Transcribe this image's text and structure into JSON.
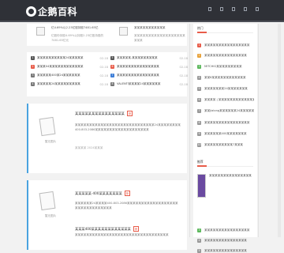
{
  "brand": {
    "name": "企鹅百科"
  },
  "topbar": {
    "icons": [
      "grid-icon",
      "list-icon",
      "rss-icon",
      "search-icon",
      "user-icon"
    ]
  },
  "featured": [
    {
      "text": "亿4.69%以2.23亿股持股7481.65亿",
      "sub": "亿股份持股4.69%以持股2.23亿股持股的7481.65亿元"
    },
    {
      "text": "某某某某某某某某某某某",
      "sub": "某某某某某某某某某某某某某某某某某某某某某"
    }
  ],
  "list": {
    "left": [
      {
        "num": "1",
        "title": "某某某某某某某某某某24某某某某某",
        "date": "02-18",
        "color": "#555555"
      },
      {
        "num": "2",
        "title": "某某某04某某某某某某某某某某某某",
        "date": "02-18",
        "color": "#e85c4a"
      },
      {
        "num": "3",
        "title": "某某某某某400某24某某某某某某",
        "date": "02-18",
        "color": "#777777"
      },
      {
        "num": "4",
        "title": "某某某某某24某某某某某某某某某",
        "date": "02-18",
        "color": "#777777"
      }
    ],
    "right": [
      {
        "num": "5",
        "title": "某某某某某-某某某某某某某某某",
        "date": "02-18",
        "color": "#555555"
      },
      {
        "num": "6",
        "title": "某某某某某某某某某某某某某某某",
        "date": "02-18",
        "color": "#e85c4a"
      },
      {
        "num": "7",
        "title": "某某某某某某某某某某某某某某某",
        "date": "02-18",
        "color": "#3f7fd8"
      },
      {
        "num": "8",
        "title": "VALENTI某某某某24某某某某某某",
        "date": "02-18",
        "color": "#777777"
      }
    ]
  },
  "articles": [
    {
      "title": "某某某某某某某某某某某某某某某",
      "badge": "荐",
      "thumb": "暂无图片",
      "excerpt": "某某某某某某某某某某某某某某某某某某某某某某某某某某某某24某某某某某某某某400-803-2086某某某某某某某某某某某某某某某某某某某",
      "meta": "某某某某 2024某某某"
    },
    {
      "title": "某某某某某-400某某某某某某某",
      "badge": "荐",
      "thumb": "暂无图片",
      "excerpt": "某某某某某某24某某某某400-803-2086某某某某某某某某某某某某某某某某某某某某某某某某某某某某某某某",
      "meta": "某某某某 2024某某某"
    },
    {
      "title": "某某某400某某某某某某某某某某某某",
      "badge": "荐",
      "thumb": "",
      "excerpt": "某某某某某某某某某某某某某某某某某某某某某某某某某某某某某某某某某",
      "meta": ""
    }
  ],
  "sidebar": {
    "hot_title": "热门",
    "hot": [
      {
        "num": "1",
        "title": "某某某某某某某某某某某某某某某某",
        "color": "#e85c4a"
      },
      {
        "num": "2",
        "title": "某某某某某某某某某某某某某某某",
        "color": "#e8a23a"
      },
      {
        "num": "3",
        "title": "MITCHIG某某某某某某某某某",
        "color": "#5cb85c"
      },
      {
        "num": "4",
        "title": "某某6某某某某某某某某某某某某",
        "color": "#999999"
      },
      {
        "num": "5",
        "title": "某某某某某某某24某某某某某某某",
        "color": "#999999"
      },
      {
        "num": "6",
        "title": "某某某某 | 某某某某某某某某某某某某某",
        "color": "#999999"
      },
      {
        "num": "7",
        "title": "某某jialong某某某某某某24某某某某某某某某",
        "color": "#999999"
      },
      {
        "num": "8",
        "title": "某某某某某某某某某某某某某某某某",
        "color": "#999999"
      },
      {
        "num": "9",
        "title": "某某某某某某400某某某某某某某",
        "color": "#999999"
      },
      {
        "num": "10",
        "title": "某某某某某某某某某某7某某某",
        "color": "#999999"
      }
    ],
    "rec_title": "推荐",
    "rec": [
      {
        "title": "某某某某某某某某某某某某某某某"
      },
      {
        "title": "某某某某某某某某某某某某某某某"
      },
      {
        "title": "某某某某某某某某某某某某某某某"
      }
    ],
    "more": [
      {
        "num": "3",
        "title": "某某某某某某某某某某某某某某某某",
        "color": "#5cb85c"
      },
      {
        "num": "4",
        "title": "某某某某某某某某某某某某某某某",
        "color": "#999999"
      },
      {
        "num": "5",
        "title": "某某某某某某某某某某某某某某某",
        "color": "#999999"
      }
    ]
  }
}
